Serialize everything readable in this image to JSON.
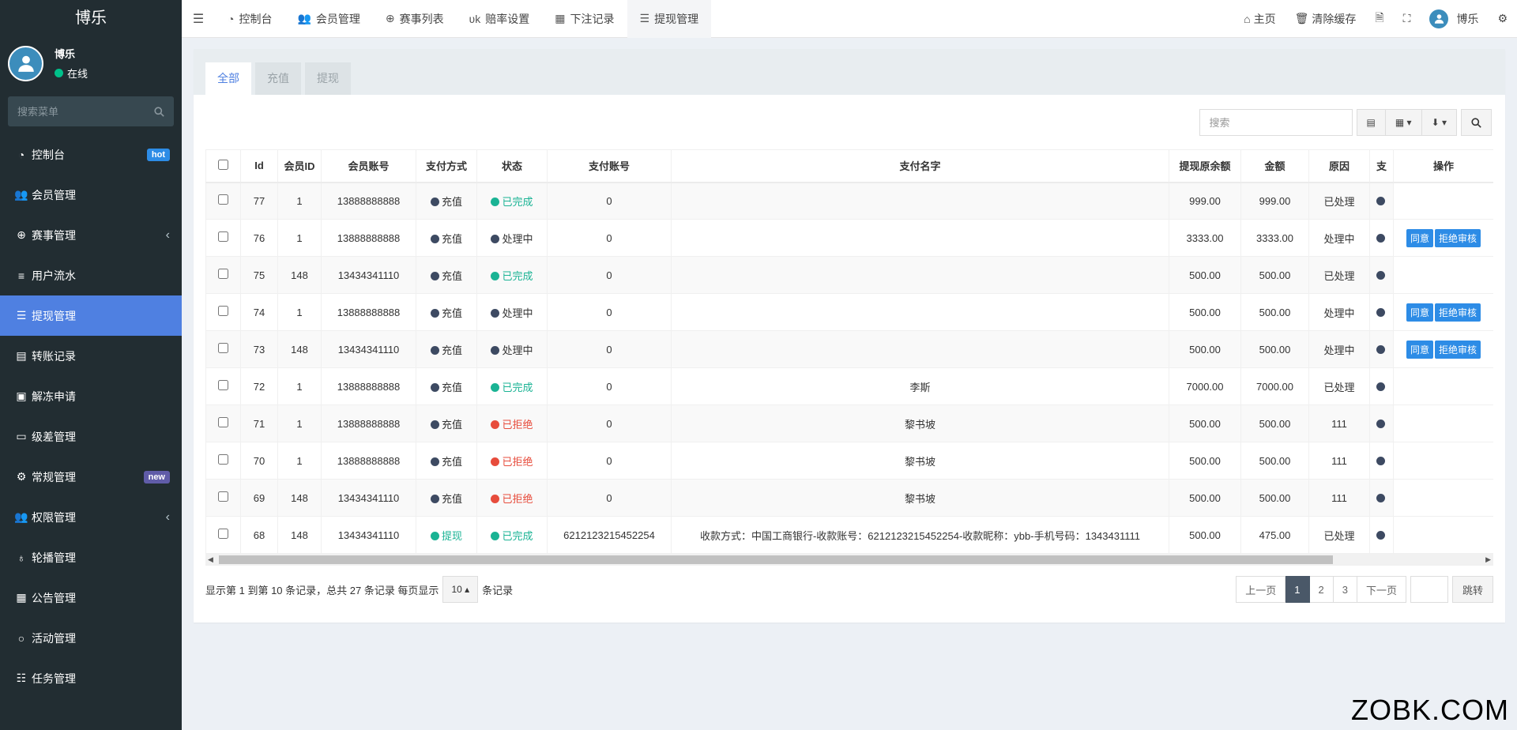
{
  "sidebar": {
    "brand": "博乐",
    "user": {
      "name": "博乐",
      "status": "在线"
    },
    "search_placeholder": "搜索菜单",
    "items": [
      {
        "label": "控制台",
        "icon": "dashboard-icon",
        "badge": "hot"
      },
      {
        "label": "会员管理",
        "icon": "users-icon"
      },
      {
        "label": "赛事管理",
        "icon": "lifebuoy-icon",
        "chevron": true
      },
      {
        "label": "用户流水",
        "icon": "list-icon"
      },
      {
        "label": "提现管理",
        "icon": "list-alt-icon",
        "active": true
      },
      {
        "label": "转账记录",
        "icon": "file-icon"
      },
      {
        "label": "解冻申请",
        "icon": "image-icon"
      },
      {
        "label": "级差管理",
        "icon": "window-icon"
      },
      {
        "label": "常规管理",
        "icon": "cogs-icon",
        "badge": "new"
      },
      {
        "label": "权限管理",
        "icon": "users-icon",
        "chevron": true
      },
      {
        "label": "轮播管理",
        "icon": "bulb-icon"
      },
      {
        "label": "公告管理",
        "icon": "notice-icon"
      },
      {
        "label": "活动管理",
        "icon": "circle-icon"
      },
      {
        "label": "任务管理",
        "icon": "tasks-icon"
      }
    ]
  },
  "header": {
    "tabs": [
      {
        "label": "控制台",
        "icon": "dashboard-icon"
      },
      {
        "label": "会员管理",
        "icon": "users-icon"
      },
      {
        "label": "赛事列表",
        "icon": "lifebuoy-icon"
      },
      {
        "label": "赔率设置",
        "icon": "vk-icon"
      },
      {
        "label": "下注记录",
        "icon": "calendar-icon"
      },
      {
        "label": "提现管理",
        "icon": "list-alt-icon",
        "active": true
      }
    ],
    "right": {
      "home": "主页",
      "clear_cache": "清除缓存",
      "user": "博乐"
    }
  },
  "panel": {
    "tabs": [
      "全部",
      "充值",
      "提现"
    ],
    "search_placeholder": "搜索"
  },
  "table": {
    "columns": [
      "Id",
      "会员ID",
      "会员账号",
      "支付方式",
      "状态",
      "支付账号",
      "支付名字",
      "提现原余额",
      "金额",
      "原因",
      "支",
      "操作"
    ],
    "rows": [
      {
        "id": "77",
        "member_id": "1",
        "account": "13888888888",
        "pay_method": "充值",
        "pay_type": "dark",
        "status": "已完成",
        "status_type": "green",
        "pay_account": "0",
        "pay_name": "",
        "balance": "999.00",
        "amount": "999.00",
        "reason": "已处理",
        "ops": false
      },
      {
        "id": "76",
        "member_id": "1",
        "account": "13888888888",
        "pay_method": "充值",
        "pay_type": "dark",
        "status": "处理中",
        "status_type": "dark",
        "pay_account": "0",
        "pay_name": "",
        "balance": "3333.00",
        "amount": "3333.00",
        "reason": "处理中",
        "ops": true
      },
      {
        "id": "75",
        "member_id": "148",
        "account": "13434341110",
        "pay_method": "充值",
        "pay_type": "dark",
        "status": "已完成",
        "status_type": "green",
        "pay_account": "0",
        "pay_name": "",
        "balance": "500.00",
        "amount": "500.00",
        "reason": "已处理",
        "ops": false
      },
      {
        "id": "74",
        "member_id": "1",
        "account": "13888888888",
        "pay_method": "充值",
        "pay_type": "dark",
        "status": "处理中",
        "status_type": "dark",
        "pay_account": "0",
        "pay_name": "",
        "balance": "500.00",
        "amount": "500.00",
        "reason": "处理中",
        "ops": true
      },
      {
        "id": "73",
        "member_id": "148",
        "account": "13434341110",
        "pay_method": "充值",
        "pay_type": "dark",
        "status": "处理中",
        "status_type": "dark",
        "pay_account": "0",
        "pay_name": "",
        "balance": "500.00",
        "amount": "500.00",
        "reason": "处理中",
        "ops": true
      },
      {
        "id": "72",
        "member_id": "1",
        "account": "13888888888",
        "pay_method": "充值",
        "pay_type": "dark",
        "status": "已完成",
        "status_type": "green",
        "pay_account": "0",
        "pay_name": "李斯",
        "balance": "7000.00",
        "amount": "7000.00",
        "reason": "已处理",
        "ops": false
      },
      {
        "id": "71",
        "member_id": "1",
        "account": "13888888888",
        "pay_method": "充值",
        "pay_type": "dark",
        "status": "已拒绝",
        "status_type": "red",
        "pay_account": "0",
        "pay_name": "黎书坡",
        "balance": "500.00",
        "amount": "500.00",
        "reason": "111",
        "ops": false
      },
      {
        "id": "70",
        "member_id": "1",
        "account": "13888888888",
        "pay_method": "充值",
        "pay_type": "dark",
        "status": "已拒绝",
        "status_type": "red",
        "pay_account": "0",
        "pay_name": "黎书坡",
        "balance": "500.00",
        "amount": "500.00",
        "reason": "111",
        "ops": false
      },
      {
        "id": "69",
        "member_id": "148",
        "account": "13434341110",
        "pay_method": "充值",
        "pay_type": "dark",
        "status": "已拒绝",
        "status_type": "red",
        "pay_account": "0",
        "pay_name": "黎书坡",
        "balance": "500.00",
        "amount": "500.00",
        "reason": "111",
        "ops": false
      },
      {
        "id": "68",
        "member_id": "148",
        "account": "13434341110",
        "pay_method": "提现",
        "pay_type": "green",
        "status": "已完成",
        "status_type": "green",
        "pay_account": "6212123215452254",
        "pay_name": "收款方式：中国工商银行-收款账号：6212123215452254-收款昵称：ybb-手机号码：1343431111",
        "balance": "500.00",
        "amount": "475.00",
        "reason": "已处理",
        "ops": false
      }
    ],
    "op_labels": {
      "approve": "同意",
      "reject": "拒绝审核"
    }
  },
  "footer": {
    "info_before": "显示第 1 到第 10 条记录，总共 27 条记录 每页显示",
    "page_size": "10",
    "info_after": "条记录",
    "prev": "上一页",
    "pages": [
      "1",
      "2",
      "3"
    ],
    "active_page": "1",
    "next": "下一页",
    "jump": "跳转"
  },
  "watermark": "ZOBK.COM",
  "colors": {
    "sidebar": "#222d32",
    "accent": "#4f80e1",
    "green": "#1ab394",
    "red": "#e74c3c",
    "dark_dot": "#3d4a62",
    "button": "#2d8ce6"
  }
}
